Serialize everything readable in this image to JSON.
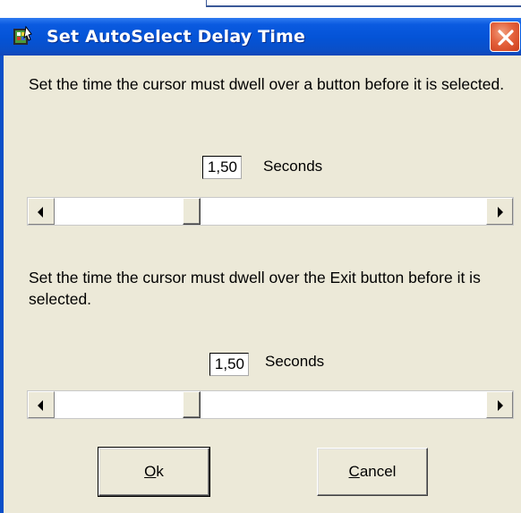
{
  "window": {
    "title": "Set AutoSelect Delay Time",
    "accent": "#0453d6",
    "close_color": "#e4623c"
  },
  "section1": {
    "instruction": "Set the time the cursor must dwell over a button before it is selected.",
    "value": "1,50",
    "unit": "Seconds",
    "slider_fraction": 0.31
  },
  "section2": {
    "instruction": "Set the time the cursor must dwell over the Exit button before it is selected.",
    "value": "1,50",
    "unit": "Seconds",
    "slider_fraction": 0.31
  },
  "buttons": {
    "ok": {
      "mnemonic": "O",
      "rest": "k"
    },
    "cancel": {
      "mnemonic": "C",
      "rest": "ancel"
    }
  },
  "icons": [
    "app-icon",
    "close-icon",
    "left-arrow-icon",
    "right-arrow-icon"
  ]
}
